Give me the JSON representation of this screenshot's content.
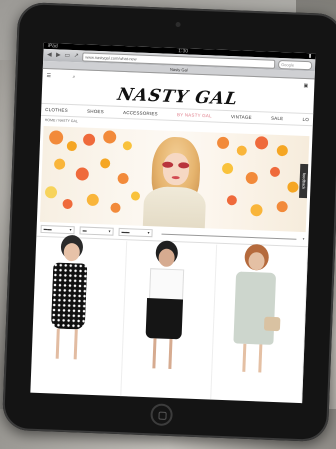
{
  "browser": {
    "status_time": "1:30",
    "url": "www.nastygal.com/what-new",
    "search_placeholder": "Google",
    "tab_title": "Nasty Gal"
  },
  "site": {
    "logo": "NASTY GAL",
    "nav": [
      "CLOTHES",
      "SHOES",
      "ACCESSORIES",
      "BY NASTY GAL",
      "VINTAGE",
      "SALE",
      "LO"
    ],
    "active_nav": "BY NASTY GAL",
    "breadcrumb": "HOME / NASTY GAL",
    "feedback": "feedback",
    "filters": [
      "",
      ""
    ],
    "colors": {
      "accent": "#e07d8a"
    }
  }
}
